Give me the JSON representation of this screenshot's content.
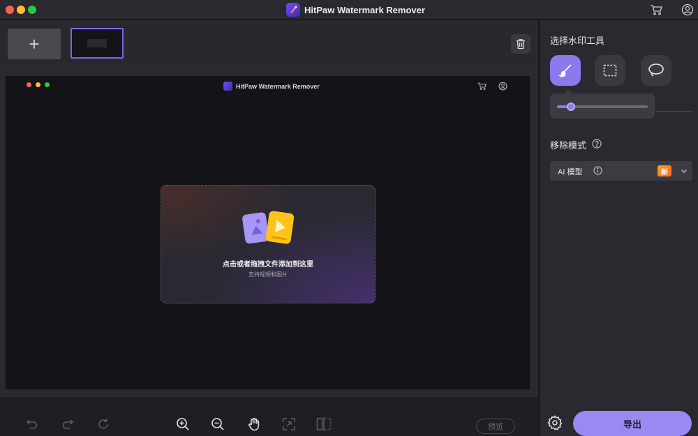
{
  "window": {
    "title": "HitPaw Watermark Remover"
  },
  "titlebar": {
    "cart_icon": "cart-icon",
    "account_icon": "user-circle-icon"
  },
  "toolbar": {
    "add_label": "+"
  },
  "canvas": {
    "inner_title": "HitPaw Watermark Remover"
  },
  "dropzone": {
    "title": "点击或者拖拽文件添加到这里",
    "subtitle": "支持视频和图片"
  },
  "bottom_bar": {
    "preview_label": "预览"
  },
  "right_panel": {
    "select_tool_heading": "选择水印工具",
    "tools": [
      "brush-icon",
      "rectangle-select-icon",
      "lasso-icon"
    ],
    "brush_size": 0.15,
    "remove_mode_heading": "移除模式",
    "mode_select_value": "AI 模型",
    "mode_badge": "新",
    "export_label": "导出"
  },
  "colors": {
    "accent": "#8b79ee",
    "badge": "#ff8a22",
    "background": "#1b1a1f"
  }
}
